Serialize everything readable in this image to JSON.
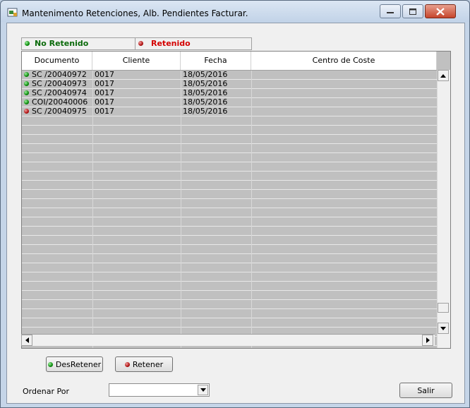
{
  "window": {
    "title": "Mantenimento Retenciones, Alb. Pendientes Facturar."
  },
  "legend": {
    "no_retenido": "No Retenido",
    "retenido": "Retenido",
    "no_retenido_color": "#0a6a0a",
    "retenido_color": "#d40000"
  },
  "grid": {
    "columns": [
      "Documento",
      "Cliente",
      "Fecha",
      "Centro de Coste"
    ],
    "rows": [
      {
        "status": "green",
        "documento": "SC /20040972",
        "cliente": "0017",
        "fecha": "18/05/2016",
        "centro": ""
      },
      {
        "status": "green",
        "documento": "SC /20040973",
        "cliente": "0017",
        "fecha": "18/05/2016",
        "centro": ""
      },
      {
        "status": "green",
        "documento": "SC /20040974",
        "cliente": "0017",
        "fecha": "18/05/2016",
        "centro": ""
      },
      {
        "status": "green",
        "documento": "COI/20040006",
        "cliente": "0017",
        "fecha": "18/05/2016",
        "centro": ""
      },
      {
        "status": "red",
        "documento": "SC /20040975",
        "cliente": "0017",
        "fecha": "18/05/2016",
        "centro": ""
      }
    ]
  },
  "buttons": {
    "desretener": "DesRetener",
    "retener": "Retener",
    "salir": "Salir"
  },
  "ordenar": {
    "label": "Ordenar Por",
    "value": ""
  }
}
